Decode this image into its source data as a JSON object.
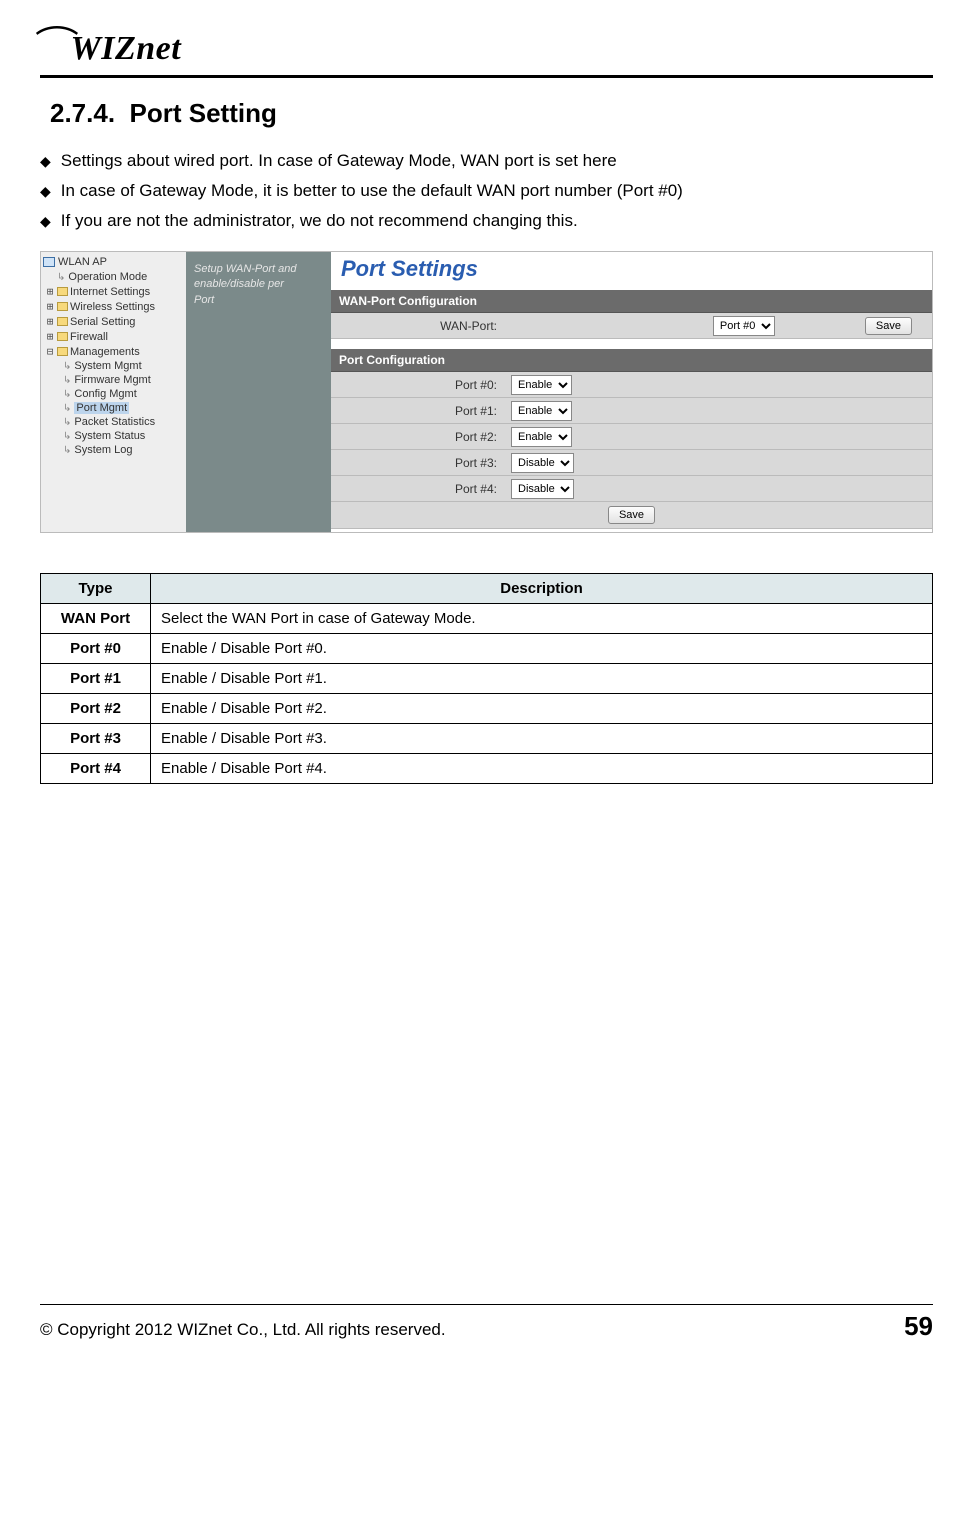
{
  "header": {
    "logo_text": "WIZnet"
  },
  "section": {
    "number": "2.7.4.",
    "title": "Port Setting",
    "bullets": [
      "Settings about wired port. In case of Gateway Mode, WAN port is set here",
      "In case of Gateway Mode, it is better to use the default WAN port number (Port #0)",
      "If you are not the administrator, we do not recommend changing this."
    ]
  },
  "screenshot": {
    "root_label": "WLAN AP",
    "tree_top": [
      "Operation Mode",
      "Internet Settings",
      "Wireless Settings",
      "Serial Setting",
      "Firewall",
      "Managements"
    ],
    "tree_mgmt_children": [
      "System Mgmt",
      "Firmware Mgmt",
      "Config Mgmt",
      "Port Mgmt",
      "Packet Statistics",
      "System Status",
      "System Log"
    ],
    "tree_selected": "Port Mgmt",
    "hint_lines": [
      "Setup WAN-Port and",
      "enable/disable per",
      "Port"
    ],
    "content_title": "Port Settings",
    "wan_section_header": "WAN-Port Configuration",
    "wan_label": "WAN-Port:",
    "wan_value": "Port #0",
    "save_label": "Save",
    "port_section_header": "Port Configuration",
    "ports": [
      {
        "label": "Port #0:",
        "value": "Enable"
      },
      {
        "label": "Port #1:",
        "value": "Enable"
      },
      {
        "label": "Port #2:",
        "value": "Enable"
      },
      {
        "label": "Port #3:",
        "value": "Disable"
      },
      {
        "label": "Port #4:",
        "value": "Disable"
      }
    ]
  },
  "desc_table": {
    "headers": {
      "type": "Type",
      "description": "Description"
    },
    "rows": [
      {
        "type": "WAN Port",
        "desc": "Select the WAN Port in case of Gateway Mode."
      },
      {
        "type": "Port #0",
        "desc": "Enable / Disable Port #0."
      },
      {
        "type": "Port #1",
        "desc": "Enable / Disable Port #1."
      },
      {
        "type": "Port #2",
        "desc": "Enable / Disable Port #2."
      },
      {
        "type": "Port #3",
        "desc": "Enable / Disable Port #3."
      },
      {
        "type": "Port #4",
        "desc": "Enable / Disable Port #4."
      }
    ]
  },
  "footer": {
    "copyright": "© Copyright 2012 WIZnet Co., Ltd. All rights reserved.",
    "page_number": "59"
  }
}
